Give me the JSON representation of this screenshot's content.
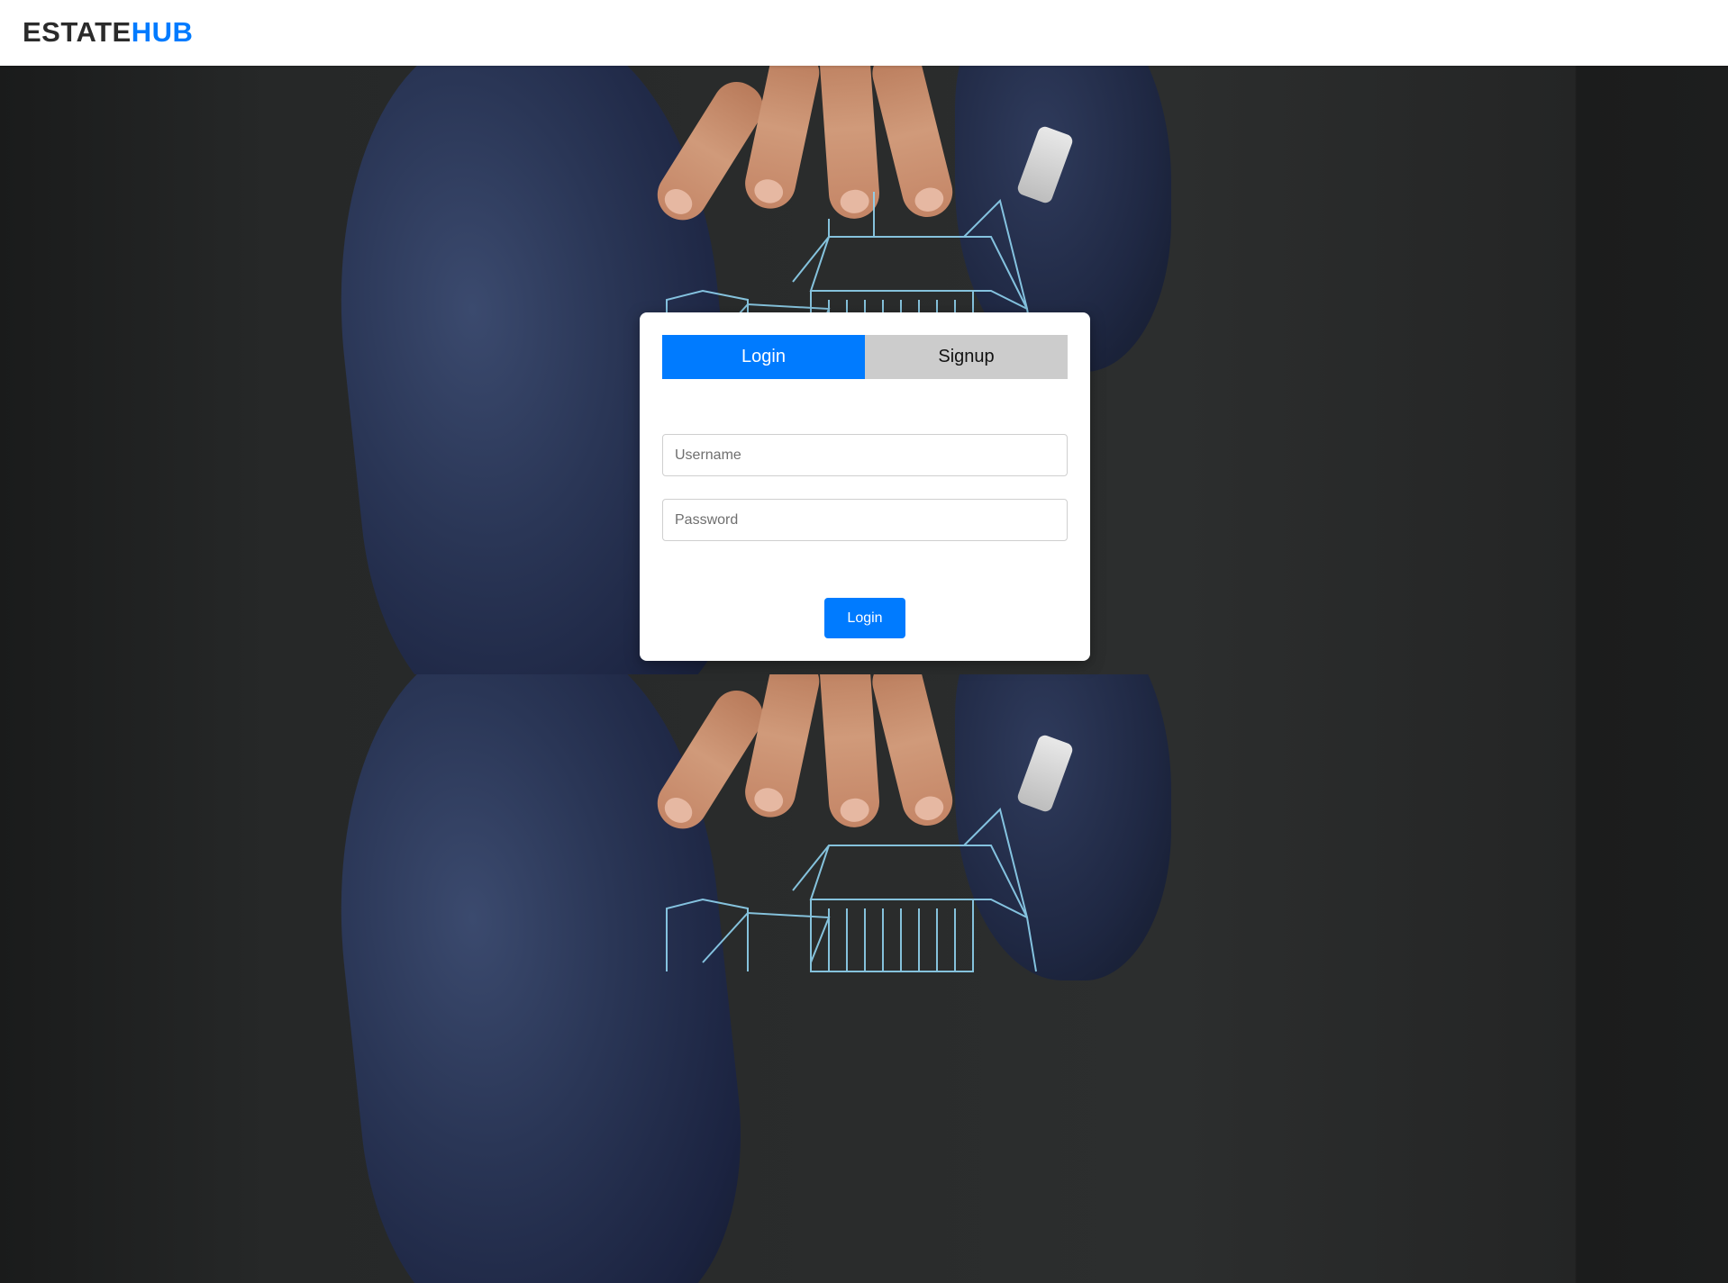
{
  "brand": {
    "part1": "ESTATE",
    "part2": "HUB"
  },
  "tabs": [
    {
      "label": "Login",
      "active": true
    },
    {
      "label": "Signup",
      "active": false
    }
  ],
  "form": {
    "username_placeholder": "Username",
    "password_placeholder": "Password",
    "submit_label": "Login"
  },
  "background": {
    "image": "businessman-hand-over-wireframe-house"
  },
  "colors": {
    "accent": "#007bff",
    "inactive_tab": "#cccccc",
    "brand_dark": "#2b2b2b"
  }
}
